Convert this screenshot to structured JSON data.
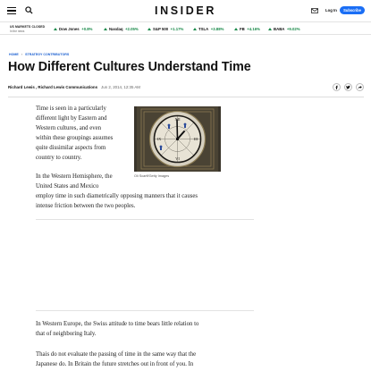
{
  "header": {
    "logo": "INSIDER",
    "login_label": "Log In",
    "subscribe_label": "Subscribe",
    "accent_color": "#1a6ef5"
  },
  "ticker": {
    "status_title": "US MARKETS CLOSED",
    "status_sub": "In the news",
    "items": [
      {
        "name": "Dow Jones",
        "change": "+0.8%"
      },
      {
        "name": "Nasdaq",
        "change": "+2.05%"
      },
      {
        "name": "S&P 500",
        "change": "+1.17%"
      },
      {
        "name": "TSLA",
        "change": "+3.88%"
      },
      {
        "name": "FB",
        "change": "+4.16%"
      },
      {
        "name": "BABA",
        "change": "+9.02%"
      }
    ],
    "positive_color": "#1a8a4a"
  },
  "breadcrumb": {
    "home": "HOME",
    "section": "STRATEGY CONTRIBUTORS"
  },
  "article": {
    "title": "How Different Cultures Understand Time",
    "authors": "Richard Lewis , Richard Lewis Communications",
    "date": "Jun 2, 2014, 12:35 AM",
    "image_caption": "Oli Scarff/Getty Images",
    "paragraphs": {
      "p1": [
        "Time is seen in a particularly",
        "different light by Eastern and",
        "Western cultures, and even",
        "within these groupings assumes",
        "quite dissimilar aspects from",
        "country to country."
      ],
      "p2": [
        "In the Western Hemisphere, the",
        "United States and Mexico",
        "employ time in such diametrically opposing manners that it causes",
        "intense friction between the two peoples."
      ],
      "p3": [
        "In Western Europe, the Swiss attitude to time bears little relation to",
        "that of neighboring Italy."
      ],
      "p4": [
        "Thais do not evaluate the passing of time in the same way that the",
        "Japanese do. In Britain the future stretches out in front of you. In"
      ]
    }
  },
  "share_icons": [
    "facebook-icon",
    "twitter-icon",
    "share-icon"
  ]
}
